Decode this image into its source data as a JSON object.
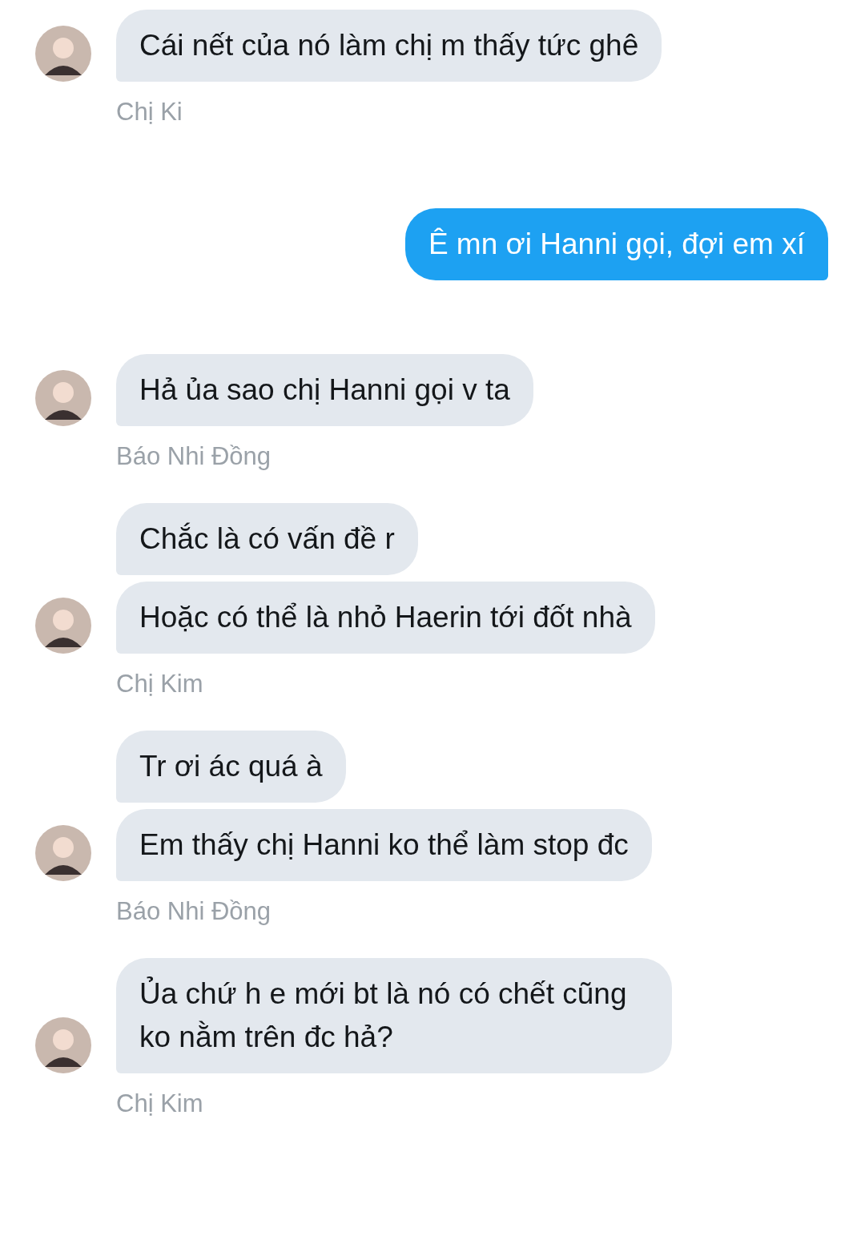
{
  "groups": [
    {
      "kind": "incoming",
      "sender": "Chị Ki",
      "messages": [
        "Cái nết của nó làm chị m thấy tức ghê"
      ]
    },
    {
      "kind": "outgoing",
      "messages": [
        "Ê mn ơi Hanni gọi, đợi em xí"
      ]
    },
    {
      "kind": "incoming",
      "sender": "Báo Nhi Đồng",
      "messages": [
        "Hả ủa sao chị Hanni gọi v ta"
      ]
    },
    {
      "kind": "incoming",
      "sender": "Chị Kim",
      "messages": [
        "Chắc là có vấn đề r",
        "Hoặc có thể là nhỏ Haerin tới đốt nhà"
      ]
    },
    {
      "kind": "incoming",
      "sender": "Báo Nhi Đồng",
      "messages": [
        "Tr ơi ác quá à",
        "Em thấy chị Hanni ko thể làm stop đc"
      ]
    },
    {
      "kind": "incoming",
      "sender": "Chị Kim",
      "messages": [
        "Ủa chứ h e mới bt là nó có chết cũng ko nằm trên đc hả?"
      ]
    }
  ]
}
